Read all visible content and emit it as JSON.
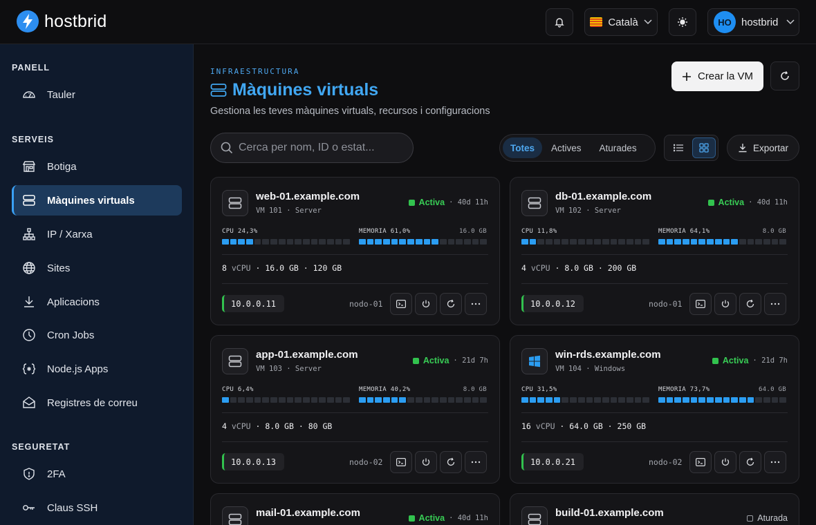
{
  "brand": {
    "name": "hostbrid"
  },
  "topbar": {
    "language": "Català",
    "user_initials": "HO",
    "user_name": "hostbrid"
  },
  "sidebar": {
    "sections": [
      {
        "title": "PANELL",
        "items": [
          {
            "label": "Tauler",
            "icon": "gauge-icon"
          }
        ]
      },
      {
        "title": "SERVEIS",
        "items": [
          {
            "label": "Botiga",
            "icon": "store-icon"
          },
          {
            "label": "Màquines virtuals",
            "icon": "server-icon",
            "active": true
          },
          {
            "label": "IP / Xarxa",
            "icon": "network-icon"
          },
          {
            "label": "Sites",
            "icon": "globe-icon"
          },
          {
            "label": "Aplicacions",
            "icon": "download-icon"
          },
          {
            "label": "Cron Jobs",
            "icon": "clock-icon"
          },
          {
            "label": "Node.js Apps",
            "icon": "braces-icon"
          },
          {
            "label": "Registres de correu",
            "icon": "mail-icon"
          }
        ]
      },
      {
        "title": "SEGURETAT",
        "items": [
          {
            "label": "2FA",
            "icon": "shield-icon"
          },
          {
            "label": "Claus SSH",
            "icon": "key-icon"
          }
        ]
      }
    ]
  },
  "header": {
    "kicker": "INFRAESTRUCTURA",
    "title": "Màquines virtuals",
    "subtitle": "Gestiona les teves màquines virtuals, recursos i configuracions",
    "create_label": "Crear la VM"
  },
  "filters": {
    "search_placeholder": "Cerca per nom, ID o estat...",
    "tabs": [
      "Totes",
      "Actives",
      "Aturades"
    ],
    "active_tab": "Totes",
    "export_label": "Exportar"
  },
  "colors": {
    "accent": "#41a7f2",
    "active": "#32c24e",
    "bar": "#2b9df2"
  },
  "vms": [
    {
      "host": "web-01.example.com",
      "vm": "VM 101",
      "os": "Server",
      "status": "Activa",
      "uptime": "40d 11h",
      "cpu_label": "CPU 24,3%",
      "cpu": 24.3,
      "mem_label": "MEMORIA 61,0%",
      "mem": 61.0,
      "mem_cap": "16.0 GB",
      "vcpu": "8",
      "ram": "16.0 GB",
      "disk": "120 GB",
      "ip": "10.0.0.11",
      "node": "nodo-01",
      "icon": "server-icon"
    },
    {
      "host": "db-01.example.com",
      "vm": "VM 102",
      "os": "Server",
      "status": "Activa",
      "uptime": "40d 11h",
      "cpu_label": "CPU 11,8%",
      "cpu": 11.8,
      "mem_label": "MEMORIA 64,1%",
      "mem": 64.1,
      "mem_cap": "8.0 GB",
      "vcpu": "4",
      "ram": "8.0 GB",
      "disk": "200 GB",
      "ip": "10.0.0.12",
      "node": "nodo-01",
      "icon": "server-icon"
    },
    {
      "host": "app-01.example.com",
      "vm": "VM 103",
      "os": "Server",
      "status": "Activa",
      "uptime": "21d 7h",
      "cpu_label": "CPU 6,4%",
      "cpu": 6.4,
      "mem_label": "MEMORIA 40,2%",
      "mem": 40.2,
      "mem_cap": "8.0 GB",
      "vcpu": "4",
      "ram": "8.0 GB",
      "disk": "80 GB",
      "ip": "10.0.0.13",
      "node": "nodo-02",
      "icon": "server-icon"
    },
    {
      "host": "win-rds.example.com",
      "vm": "VM 104",
      "os": "Windows",
      "status": "Activa",
      "uptime": "21d 7h",
      "cpu_label": "CPU 31,5%",
      "cpu": 31.5,
      "mem_label": "MEMORIA 73,7%",
      "mem": 73.7,
      "mem_cap": "64.0 GB",
      "vcpu": "16",
      "ram": "64.0 GB",
      "disk": "250 GB",
      "ip": "10.0.0.21",
      "node": "nodo-02",
      "icon": "windows-icon"
    },
    {
      "host": "mail-01.example.com",
      "status": "Activa",
      "uptime": "40d 11h",
      "icon": "server-icon"
    },
    {
      "host": "build-01.example.com",
      "status": "Aturada",
      "icon": "server-icon"
    }
  ],
  "labels": {
    "vcpu_unit": "vCPU",
    "sep": "·"
  }
}
